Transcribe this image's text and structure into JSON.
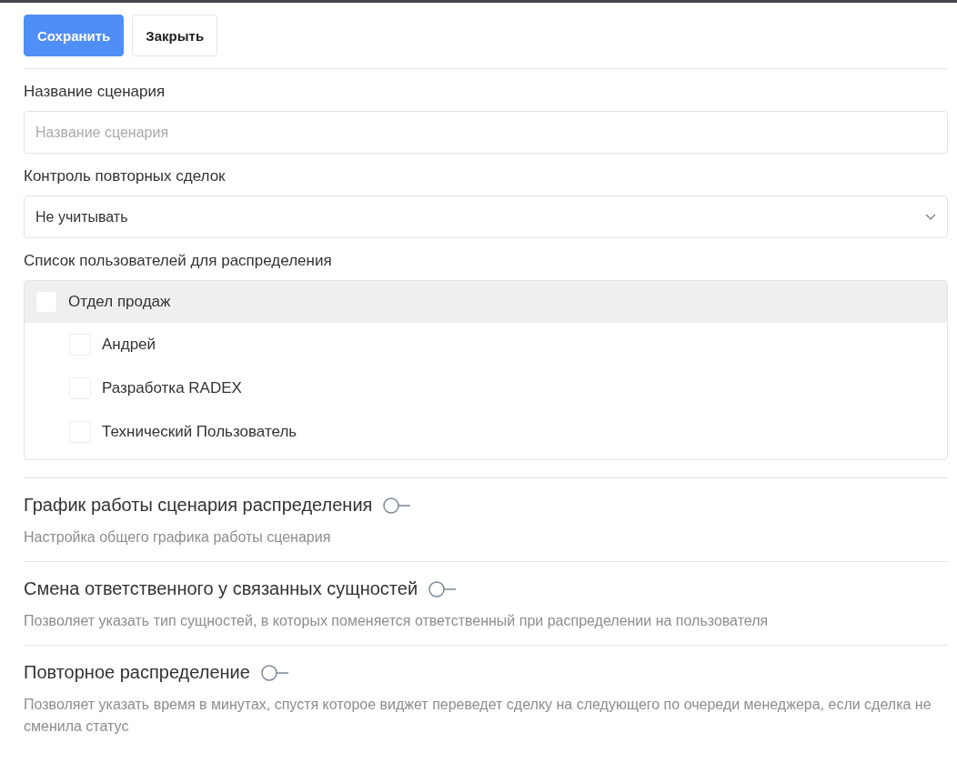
{
  "toolbar": {
    "buttons": [
      {
        "label": "Сохранить",
        "kind": "primary"
      },
      {
        "label": "Закрыть",
        "kind": "secondary"
      }
    ]
  },
  "fields": [
    {
      "kind": "text",
      "label": "Название сценария",
      "placeholder": "Название сценария"
    },
    {
      "kind": "select",
      "label": "Контроль повторных сделок",
      "value": "Не учитывать"
    }
  ],
  "users": {
    "label": "Список пользователей для распределения",
    "tree": [
      {
        "label": "Отдел продаж",
        "checked": false,
        "children": [
          {
            "label": "Андрей",
            "checked": false
          },
          {
            "label": "Разработка RADEX",
            "checked": false
          },
          {
            "label": "Технический Пользователь",
            "checked": false
          }
        ]
      }
    ]
  },
  "sections": [
    {
      "title": "График работы сценария распределения",
      "on": false,
      "description": "Настройка общего графика работы сценария"
    },
    {
      "title": "Смена ответственного у связанных сущностей",
      "on": false,
      "description": "Позволяет указать тип сущностей, в которых поменяется ответственный при распределении на пользователя"
    },
    {
      "title": "Повторное распределение",
      "on": false,
      "description": "Позволяет указать время в минутах, спустя которое виджет переведет сделку на следующего по очереди менеджера, если сделка не сменила статус"
    }
  ]
}
